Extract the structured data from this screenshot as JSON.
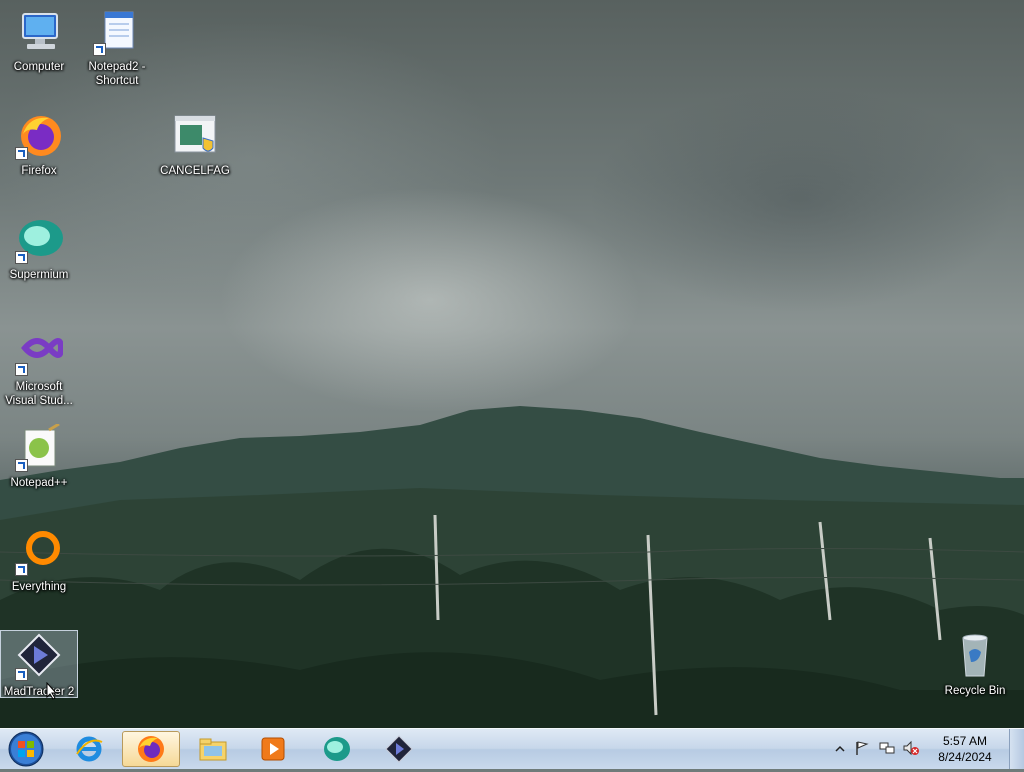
{
  "desktop": {
    "icons": [
      {
        "label": "Computer",
        "icon": "computer-icon"
      },
      {
        "label": "Notepad2 - Shortcut",
        "icon": "notepad2-icon"
      },
      {
        "label": "Firefox",
        "icon": "firefox-icon"
      },
      {
        "label": "CANCELFAG",
        "icon": "cancelfag-app-icon"
      },
      {
        "label": "Supermium",
        "icon": "supermium-icon"
      },
      {
        "label": "Microsoft Visual Stud...",
        "icon": "visual-studio-icon"
      },
      {
        "label": "Notepad++",
        "icon": "notepadpp-icon"
      },
      {
        "label": "Everything",
        "icon": "everything-icon"
      },
      {
        "label": "MadTracker 2",
        "icon": "madtracker-icon"
      },
      {
        "label": "Recycle Bin",
        "icon": "recycle-bin-icon"
      }
    ]
  },
  "taskbar": {
    "start": "start-orb-icon",
    "pinned": [
      "internet-explorer-icon",
      "firefox-icon",
      "file-explorer-icon",
      "media-player-icon",
      "supermium-icon",
      "madtracker-icon"
    ],
    "active_item": "firefox-icon"
  },
  "tray": {
    "time": "5:57 AM",
    "date": "8/24/2024",
    "icons": [
      "show-hidden-icons-chevron",
      "action-center-flag-icon",
      "network-icon",
      "volume-muted-icon"
    ]
  },
  "colors": {
    "taskbar_top": "#dfe9f5",
    "taskbar_bottom": "#b7cbe3",
    "sky": "#7b8584",
    "hills": "#2f4a3a"
  }
}
